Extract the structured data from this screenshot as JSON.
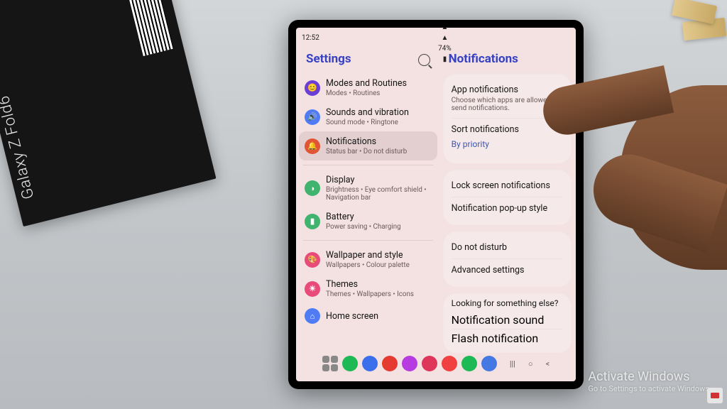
{
  "product_box": {
    "label": "Galaxy Z Fold6"
  },
  "status_bar": {
    "time": "12:52",
    "battery": "74%"
  },
  "left_pane": {
    "title": "Settings",
    "groups": [
      [
        {
          "icon": "😊",
          "color": "#6b3fd6",
          "title": "Modes and Routines",
          "sub": "Modes • Routines"
        },
        {
          "icon": "🔊",
          "color": "#4f7bf5",
          "title": "Sounds and vibration",
          "sub": "Sound mode • Ringtone"
        },
        {
          "icon": "🔔",
          "color": "#e15436",
          "title": "Notifications",
          "sub": "Status bar • Do not disturb",
          "selected": true
        }
      ],
      [
        {
          "icon": "◑",
          "color": "#40b36f",
          "title": "Display",
          "sub": "Brightness • Eye comfort shield • Navigation bar"
        },
        {
          "icon": "▮",
          "color": "#40b36f",
          "title": "Battery",
          "sub": "Power saving • Charging"
        }
      ],
      [
        {
          "icon": "🎨",
          "color": "#e84a7a",
          "title": "Wallpaper and style",
          "sub": "Wallpapers • Colour palette"
        },
        {
          "icon": "☀",
          "color": "#e84a7a",
          "title": "Themes",
          "sub": "Themes • Wallpapers • Icons"
        },
        {
          "icon": "⌂",
          "color": "#4f7bf5",
          "title": "Home screen",
          "sub": ""
        }
      ]
    ]
  },
  "right_pane": {
    "title": "Notifications",
    "cards": [
      [
        {
          "title": "App notifications",
          "sub": "Choose which apps are allowed to send notifications."
        },
        {
          "title": "Sort notifications",
          "sub": "By priority",
          "sub_link": true
        }
      ],
      [
        {
          "title": "Lock screen notifications"
        },
        {
          "title": "Notification pop-up style"
        }
      ],
      [
        {
          "title": "Do not disturb"
        },
        {
          "title": "Advanced settings"
        }
      ]
    ],
    "else": {
      "heading": "Looking for something else?",
      "links": [
        "Notification sound",
        "Flash notification"
      ]
    }
  },
  "dock": {
    "apps": [
      {
        "name": "apps-drawer",
        "color": ""
      },
      {
        "name": "phone",
        "color": "#1db954"
      },
      {
        "name": "messages",
        "color": "#3b6eea"
      },
      {
        "name": "flipboard",
        "color": "#e43a2f"
      },
      {
        "name": "files",
        "color": "#b63be0"
      },
      {
        "name": "store",
        "color": "#e0355b"
      },
      {
        "name": "youtube",
        "color": "#f14040"
      },
      {
        "name": "spotify",
        "color": "#1db954"
      },
      {
        "name": "drive",
        "color": "#4478e3"
      }
    ],
    "nav": [
      "|||",
      "○",
      "<"
    ]
  },
  "watermark": {
    "title": "Activate Windows",
    "sub": "Go to Settings to activate Windows."
  }
}
